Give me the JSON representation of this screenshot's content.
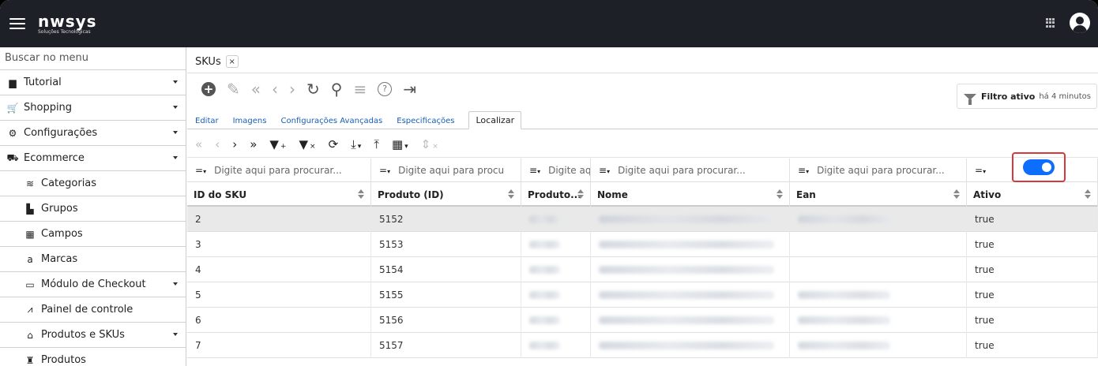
{
  "header": {
    "logo_main": "nwsys",
    "logo_sub": "Soluções Tecnológicas"
  },
  "sidebar": {
    "search_placeholder": "Buscar no menu",
    "items": [
      {
        "label": "Tutorial",
        "icon": "book-icon",
        "glyph": "▆",
        "expandable": true,
        "sub": false
      },
      {
        "label": "Shopping",
        "icon": "cart-icon",
        "glyph": "🛒",
        "expandable": true,
        "sub": false
      },
      {
        "label": "Configurações",
        "icon": "toggle-icon",
        "glyph": "⚙",
        "expandable": true,
        "sub": false
      },
      {
        "label": "Ecommerce",
        "icon": "basket-icon",
        "glyph": "⛟",
        "expandable": true,
        "sub": false
      },
      {
        "label": "Categorias",
        "icon": "layers-icon",
        "glyph": "≋",
        "expandable": false,
        "sub": true
      },
      {
        "label": "Grupos",
        "icon": "boxes-icon",
        "glyph": "▙",
        "expandable": false,
        "sub": true
      },
      {
        "label": "Campos",
        "icon": "table-icon",
        "glyph": "▦",
        "expandable": false,
        "sub": true
      },
      {
        "label": "Marcas",
        "icon": "amazon-icon",
        "glyph": "a",
        "expandable": false,
        "sub": true
      },
      {
        "label": "Módulo de Checkout",
        "icon": "card-icon",
        "glyph": "▭",
        "expandable": true,
        "sub": true
      },
      {
        "label": "Painel de controle",
        "icon": "chart-line-icon",
        "glyph": "⩘",
        "expandable": false,
        "sub": true
      },
      {
        "label": "Produtos e SKUs",
        "icon": "warehouse-icon",
        "glyph": "⌂",
        "expandable": true,
        "sub": true
      },
      {
        "label": "Produtos",
        "icon": "tshirt-icon",
        "glyph": "♜",
        "expandable": false,
        "sub": true
      }
    ]
  },
  "tabs": [
    {
      "label": "SKUs",
      "close": "×"
    }
  ],
  "subtabs": [
    {
      "label": "Editar",
      "active": false
    },
    {
      "label": "Imagens",
      "active": false
    },
    {
      "label": "Configurações Avançadas",
      "active": false
    },
    {
      "label": "Especificações",
      "active": false
    },
    {
      "label": "Localizar",
      "active": true
    }
  ],
  "filter_chip": {
    "bold": "Filtro ativo",
    "time": "há 4 minutos",
    "close": "×"
  },
  "grid": {
    "filter_op": "=",
    "filter_op_text": "≡",
    "filter_placeholders": [
      "Digite aqui para procurar...",
      "Digite aqui para procu",
      "Digite aqui para procurar...",
      "Digite aqui para procurar...",
      "Digite aqui para procurar..."
    ],
    "columns": [
      "ID do SKU",
      "Produto (ID)",
      "Produto...",
      "Nome",
      "Ean",
      "Ativo"
    ],
    "rows": [
      {
        "id": "2",
        "produto": "5152",
        "ativo": "true",
        "ean": true
      },
      {
        "id": "3",
        "produto": "5153",
        "ativo": "true",
        "ean": false
      },
      {
        "id": "4",
        "produto": "5154",
        "ativo": "true",
        "ean": false
      },
      {
        "id": "5",
        "produto": "5155",
        "ativo": "true",
        "ean": true
      },
      {
        "id": "6",
        "produto": "5156",
        "ativo": "true",
        "ean": true
      },
      {
        "id": "7",
        "produto": "5157",
        "ativo": "true",
        "ean": true
      }
    ]
  },
  "colors": {
    "header_bg": "#1d2127",
    "toggle_on": "#0d6efd",
    "highlight_box": "#d9383a",
    "link": "#1a5fb4"
  }
}
